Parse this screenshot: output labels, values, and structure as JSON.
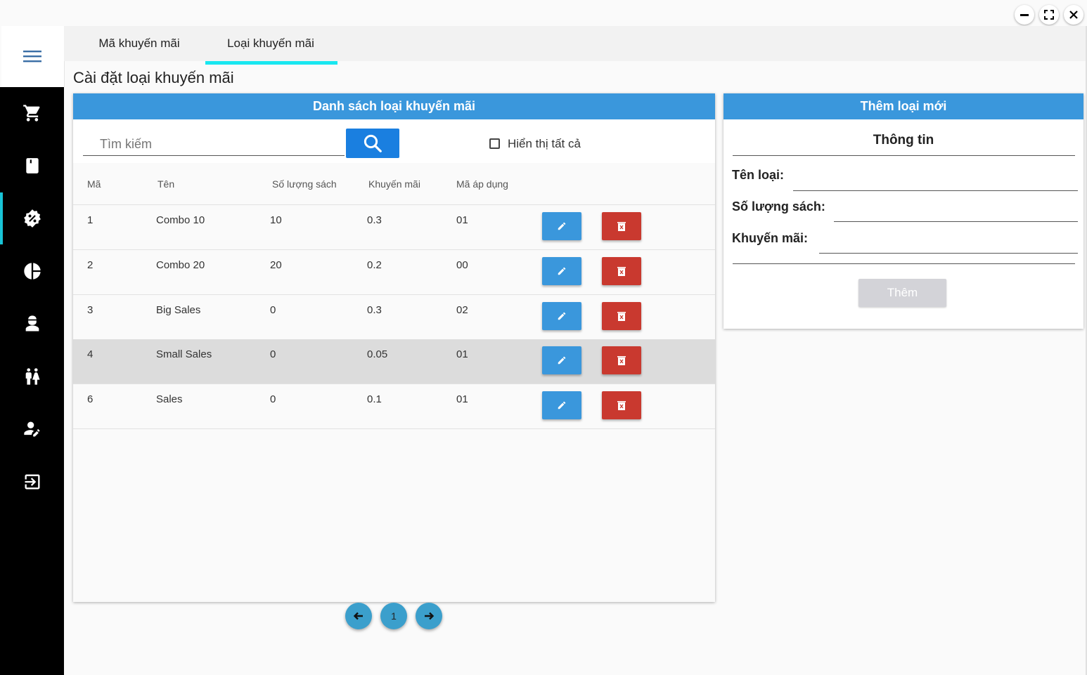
{
  "window": {
    "minimize_icon": "minimize-icon",
    "maximize_icon": "maximize-icon",
    "close_icon": "close-icon"
  },
  "sidebar": {
    "menu_icon": "hamburger-menu-icon",
    "items": [
      {
        "icon": "cart-icon"
      },
      {
        "icon": "book-icon"
      },
      {
        "icon": "discount-badge-icon",
        "active": true
      },
      {
        "icon": "pie-chart-icon"
      },
      {
        "icon": "worker-icon"
      },
      {
        "icon": "people-icon"
      },
      {
        "icon": "user-edit-icon"
      },
      {
        "icon": "logout-icon"
      }
    ],
    "active_color": "#18c4d6"
  },
  "tabs": [
    {
      "label": "Mã khuyến mãi"
    },
    {
      "label": "Loại khuyến mãi",
      "active": true
    }
  ],
  "page_title": "Cài đặt loại khuyến mãi",
  "list_panel": {
    "header": "Danh sách loại khuyến mãi",
    "search_placeholder": "Tìm kiếm",
    "search_value": "",
    "show_all_label": "Hiển thị tất cả",
    "show_all_checked": false,
    "columns": [
      "Mã",
      "Tên",
      "Số lượng sách",
      "Khuyến mãi",
      "Mã áp dụng"
    ],
    "rows": [
      {
        "id": "1",
        "name": "Combo 10",
        "qty": "10",
        "discount": "0.3",
        "code": "01"
      },
      {
        "id": "2",
        "name": "Combo 20",
        "qty": "20",
        "discount": "0.2",
        "code": "00"
      },
      {
        "id": "3",
        "name": "Big Sales",
        "qty": "0",
        "discount": "0.3",
        "code": "02"
      },
      {
        "id": "4",
        "name": "Small Sales",
        "qty": "0",
        "discount": "0.05",
        "code": "01",
        "highlighted": true
      },
      {
        "id": "6",
        "name": "Sales",
        "qty": "0",
        "discount": "0.1",
        "code": "01"
      }
    ]
  },
  "form_panel": {
    "header": "Thêm loại mới",
    "section_title": "Thông tin",
    "name_label": "Tên loại:",
    "qty_label": "Số lượng sách:",
    "discount_label": "Khuyến mãi:",
    "name_value": "",
    "qty_value": "",
    "discount_value": "",
    "submit_label": "Thêm"
  },
  "pagination": {
    "current_page": "1"
  },
  "colors": {
    "primary": "#3a97dc",
    "danger": "#c9392f",
    "accent": "#18e7f0"
  }
}
